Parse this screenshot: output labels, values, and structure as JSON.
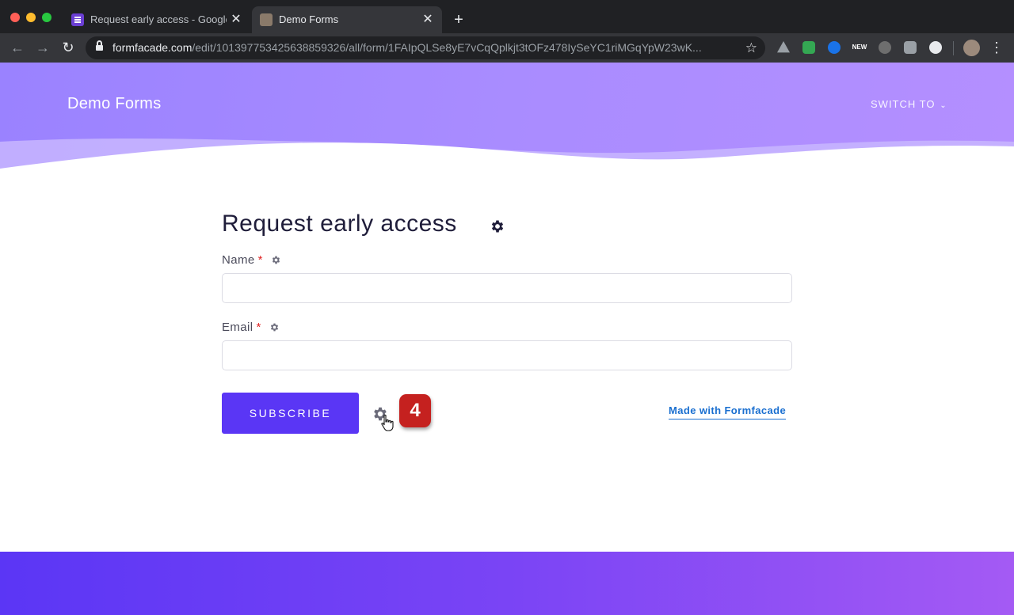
{
  "browser": {
    "tabs": [
      {
        "title": "Request early access - Google Forms",
        "favicon": "google-forms-icon",
        "active": false
      },
      {
        "title": "Demo Forms",
        "favicon": "site-avatar-icon",
        "active": true
      }
    ],
    "close_glyph": "✕",
    "new_tab_glyph": "+",
    "url_host": "formfacade.com",
    "url_path": "/edit/101397753425638859326/all/form/1FAIpQLSe8yE7vCqQplkjt3tOFz478IySeYC1riMGqYpW23wK...",
    "ext_new_label": "NEW",
    "colors": {
      "tabbar": "#202124",
      "toolbar": "#35363a"
    }
  },
  "header": {
    "brand": "Demo Forms",
    "switch_to": "SWITCH TO"
  },
  "form": {
    "title": "Request early access",
    "fields": [
      {
        "label": "Name",
        "required": "*",
        "value": ""
      },
      {
        "label": "Email",
        "required": "*",
        "value": ""
      }
    ],
    "submit_label": "SUBSCRIBE",
    "step_badge": "4",
    "made_with": "Made with Formfacade"
  },
  "colors": {
    "accent": "#5a36f5",
    "hero_start": "#9a82ff",
    "hero_end": "#b48fff",
    "badge": "#c5211f",
    "link": "#1a6fd0"
  }
}
